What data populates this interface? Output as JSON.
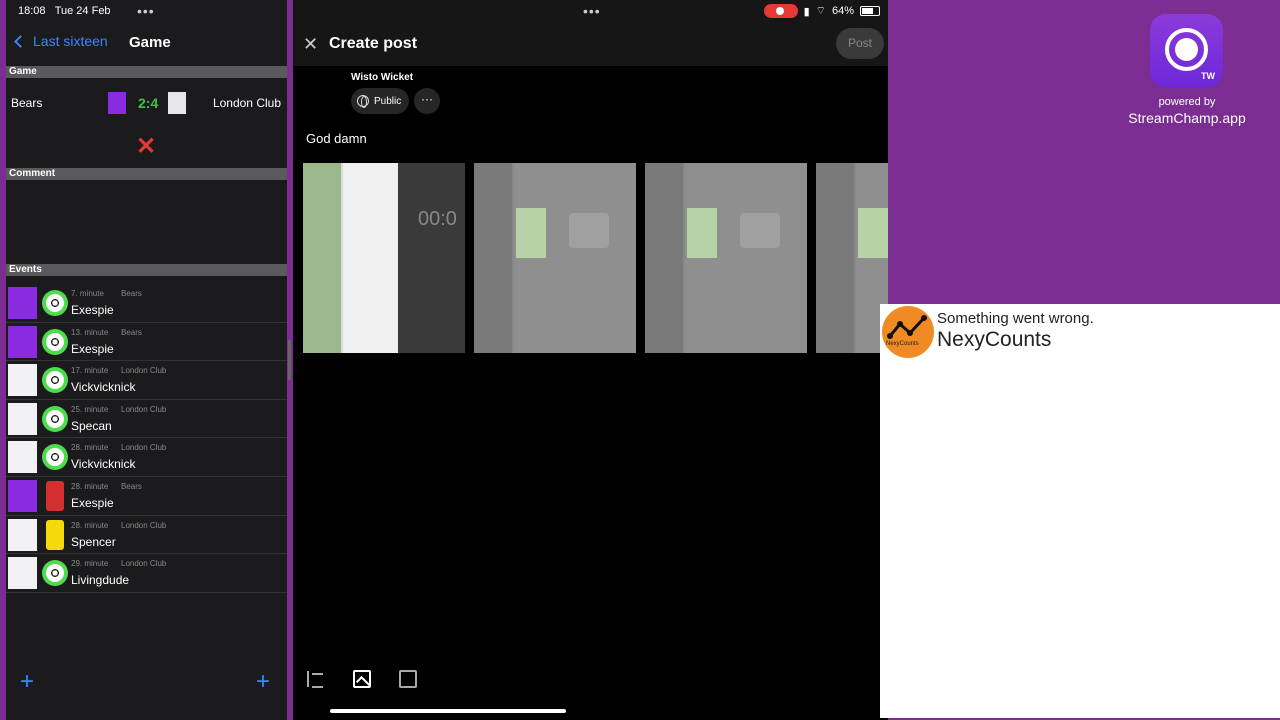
{
  "status": {
    "time": "18:08",
    "date": "Tue 24 Feb",
    "battery": "64%"
  },
  "left_app": {
    "back_label": "Last sixteen",
    "title": "Game",
    "sections": {
      "game": "Game",
      "comment": "Comment",
      "events": "Events"
    },
    "game": {
      "home": "Bears",
      "away": "London Club",
      "score": "2:4",
      "home_color": "#8a2be2",
      "away_color": "#e6e6ea"
    },
    "events": [
      {
        "minute": "7. minute",
        "team": "Bears",
        "player": "Exespie",
        "type": "goal",
        "team_color": "#8a2be2"
      },
      {
        "minute": "13. minute",
        "team": "Bears",
        "player": "Exespie",
        "type": "goal",
        "team_color": "#8a2be2"
      },
      {
        "minute": "17. minute",
        "team": "London Club",
        "player": "Vickvicknick",
        "type": "goal",
        "team_color": "#f2f2f5"
      },
      {
        "minute": "25. minute",
        "team": "London Club",
        "player": "Specan",
        "type": "goal",
        "team_color": "#f2f2f5"
      },
      {
        "minute": "28. minute",
        "team": "London Club",
        "player": "Vickvicknick",
        "type": "goal",
        "team_color": "#f2f2f5"
      },
      {
        "minute": "28. minute",
        "team": "Bears",
        "player": "Exespie",
        "type": "red-card",
        "team_color": "#8a2be2"
      },
      {
        "minute": "28. minute",
        "team": "London Club",
        "player": "Spencer",
        "type": "yellow-card",
        "team_color": "#f2f2f5"
      },
      {
        "minute": "29. minute",
        "team": "London Club",
        "player": "Livingdude",
        "type": "goal",
        "team_color": "#f2f2f5"
      }
    ]
  },
  "create_post": {
    "title": "Create post",
    "post_button": "Post",
    "author": "Wisto Wicket",
    "privacy": "Public",
    "text": "God damn",
    "thumb_clock": "00:0"
  },
  "streamchamp": {
    "badge": "TW",
    "powered": "powered by",
    "brand": "StreamChamp.app"
  },
  "nexy": {
    "error": "Something went wrong.",
    "name": "NexyCounts",
    "logo_label": "NexyCounts"
  },
  "colors": {
    "accent": "#3a86ff",
    "brand_purple": "#7b2d91",
    "score_green": "#3ec24a",
    "danger": "#e53935"
  }
}
